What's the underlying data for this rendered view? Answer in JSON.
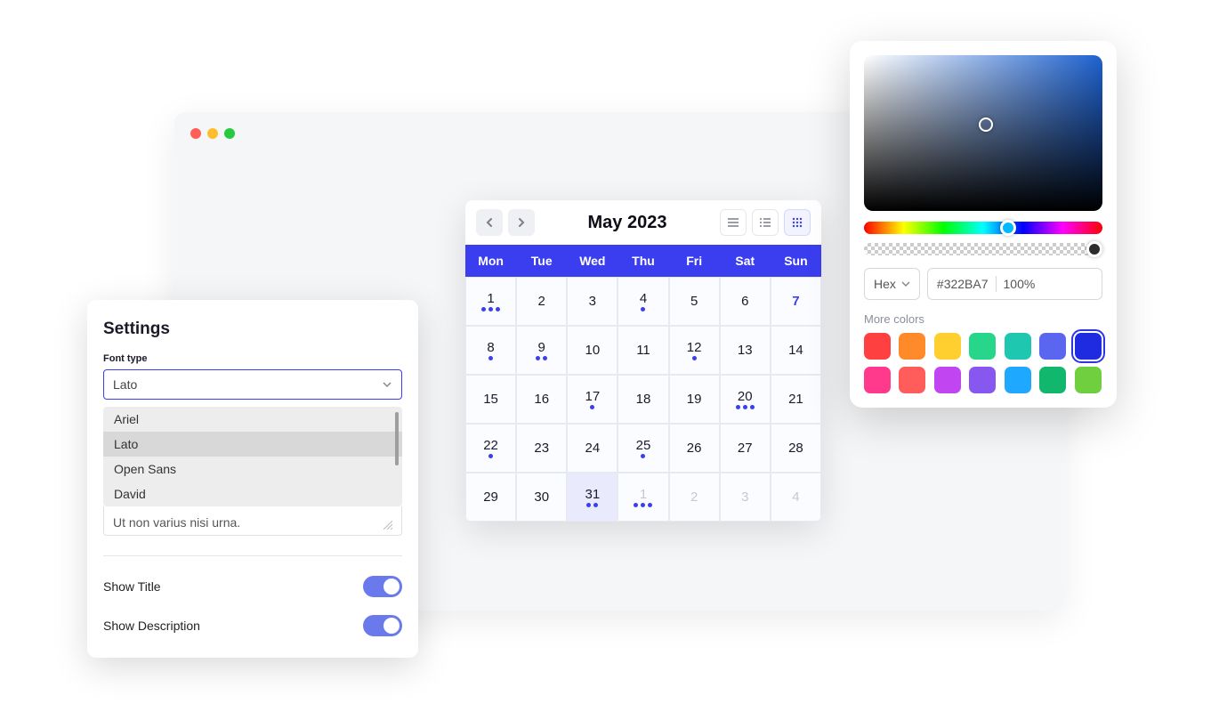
{
  "calendar": {
    "title": "May 2023",
    "day_names": [
      "Mon",
      "Tue",
      "Wed",
      "Thu",
      "Fri",
      "Sat",
      "Sun"
    ],
    "cells": [
      {
        "n": "1",
        "dots": 3
      },
      {
        "n": "2",
        "dots": 0
      },
      {
        "n": "3",
        "dots": 0
      },
      {
        "n": "4",
        "dots": 1
      },
      {
        "n": "5",
        "dots": 0
      },
      {
        "n": "6",
        "dots": 0
      },
      {
        "n": "7",
        "dots": 0,
        "highlight": true
      },
      {
        "n": "8",
        "dots": 1
      },
      {
        "n": "9",
        "dots": 2
      },
      {
        "n": "10",
        "dots": 0
      },
      {
        "n": "11",
        "dots": 0
      },
      {
        "n": "12",
        "dots": 1
      },
      {
        "n": "13",
        "dots": 0
      },
      {
        "n": "14",
        "dots": 0
      },
      {
        "n": "15",
        "dots": 0
      },
      {
        "n": "16",
        "dots": 0
      },
      {
        "n": "17",
        "dots": 1
      },
      {
        "n": "18",
        "dots": 0
      },
      {
        "n": "19",
        "dots": 0
      },
      {
        "n": "20",
        "dots": 3
      },
      {
        "n": "21",
        "dots": 0
      },
      {
        "n": "22",
        "dots": 1
      },
      {
        "n": "23",
        "dots": 0
      },
      {
        "n": "24",
        "dots": 0
      },
      {
        "n": "25",
        "dots": 1
      },
      {
        "n": "26",
        "dots": 0
      },
      {
        "n": "27",
        "dots": 0
      },
      {
        "n": "28",
        "dots": 0
      },
      {
        "n": "29",
        "dots": 0
      },
      {
        "n": "30",
        "dots": 0
      },
      {
        "n": "31",
        "dots": 2,
        "selected": true
      },
      {
        "n": "1",
        "dots": 3,
        "other": true
      },
      {
        "n": "2",
        "dots": 0,
        "other": true
      },
      {
        "n": "3",
        "dots": 0,
        "other": true
      },
      {
        "n": "4",
        "dots": 0,
        "other": true
      }
    ]
  },
  "settings": {
    "title": "Settings",
    "font_type_label": "Font type",
    "font_selected": "Lato",
    "font_options": [
      "Ariel",
      "Lato",
      "Open Sans",
      "David"
    ],
    "font_option_hover_index": 1,
    "textarea_value": "Ut non varius nisi urna.",
    "show_title_label": "Show Title",
    "show_title_on": true,
    "show_description_label": "Show Description",
    "show_description_on": true
  },
  "color_picker": {
    "format_label": "Hex",
    "hex_value": "#322BA7",
    "alpha_value": "100%",
    "more_colors_label": "More colors",
    "swatches": [
      "#ff4040",
      "#ff8a2a",
      "#ffcf30",
      "#27d68b",
      "#1ec8b0",
      "#5b66f0",
      "#1e2be0",
      "#ff3a8c",
      "#ff5c5c",
      "#c146f2",
      "#8857f0",
      "#1ea8ff",
      "#11b76c",
      "#6fcf3e"
    ],
    "selected_swatch_index": 6
  }
}
